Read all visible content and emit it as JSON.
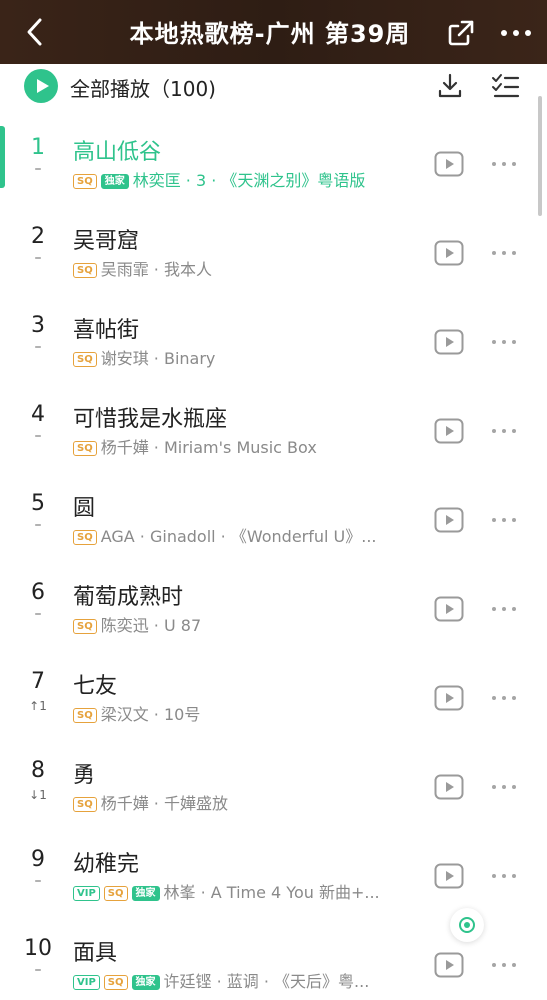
{
  "header": {
    "title": "本地热歌榜-广州 第39周",
    "back_icon": "chevron-left-icon",
    "share_icon": "share-icon",
    "more_icon": "more-horizontal-icon"
  },
  "toolbar": {
    "play_all_label": "全部播放（100)",
    "download_icon": "download-icon",
    "multi_select_icon": "multi-select-icon"
  },
  "colors": {
    "header_bg": "#35221a",
    "accent": "#2fc38c",
    "sq_tag": "#e6a23c",
    "meta_text": "#8a8a8a"
  },
  "songs": [
    {
      "rank": "1",
      "trend": "–",
      "title": "高山低谷",
      "tags": [
        "SQ",
        "独家"
      ],
      "meta": "林奕匡 · 3 · 《天渊之别》粤语版",
      "active": true
    },
    {
      "rank": "2",
      "trend": "–",
      "title": "吴哥窟",
      "tags": [
        "SQ"
      ],
      "meta": "吴雨霏 · 我本人",
      "active": false
    },
    {
      "rank": "3",
      "trend": "–",
      "title": "喜帖街",
      "tags": [
        "SQ"
      ],
      "meta": "谢安琪 · Binary",
      "active": false
    },
    {
      "rank": "4",
      "trend": "–",
      "title": "可惜我是水瓶座",
      "tags": [
        "SQ"
      ],
      "meta": "杨千嬅 · Miriam's Music Box",
      "active": false
    },
    {
      "rank": "5",
      "trend": "–",
      "title": "圆",
      "tags": [
        "SQ"
      ],
      "meta": "AGA · Ginadoll · 《Wonderful U》...",
      "active": false
    },
    {
      "rank": "6",
      "trend": "–",
      "title": "葡萄成熟时",
      "tags": [
        "SQ"
      ],
      "meta": "陈奕迅 · U 87",
      "active": false
    },
    {
      "rank": "7",
      "trend": "↑1",
      "title": "七友",
      "tags": [
        "SQ"
      ],
      "meta": "梁汉文 · 10号",
      "active": false
    },
    {
      "rank": "8",
      "trend": "↓1",
      "title": "勇",
      "tags": [
        "SQ"
      ],
      "meta": "杨千嬅 · 千嬅盛放",
      "active": false
    },
    {
      "rank": "9",
      "trend": "–",
      "title": "幼稚完",
      "tags": [
        "VIP",
        "SQ",
        "独家"
      ],
      "meta": "林峯 · A Time 4 You 新曲+...",
      "active": false
    },
    {
      "rank": "10",
      "trend": "–",
      "title": "面具",
      "tags": [
        "VIP",
        "SQ",
        "独家"
      ],
      "meta": "许廷铿 · 蓝调 · 《天后》粤...",
      "active": false
    }
  ]
}
